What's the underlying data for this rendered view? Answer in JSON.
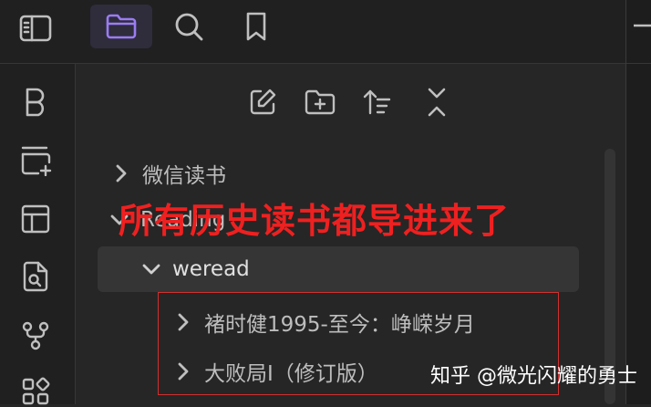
{
  "toolbar": {
    "icons": [
      "sidebar-toggle-icon",
      "folder-icon",
      "search-icon",
      "bookmark-icon"
    ],
    "active": "folder-icon"
  },
  "rail": {
    "icons": [
      "b-letter-icon",
      "add-card-icon",
      "layout-icon",
      "file-search-icon",
      "graph-icon",
      "grid-icon"
    ]
  },
  "file_panel_actions": [
    "new-note-icon",
    "new-folder-icon",
    "sort-icon",
    "collapse-all-icon"
  ],
  "tree": {
    "items": [
      {
        "label": "微信读书",
        "expanded": false
      },
      {
        "label": "Reading",
        "expanded": true
      },
      {
        "label": "weread",
        "expanded": true,
        "selected": true
      },
      {
        "label": "褚时健1995-至今：峥嵘岁月",
        "expanded": false
      },
      {
        "label": "大败局I（修订版）",
        "expanded": false
      }
    ]
  },
  "annotation": "所有历史读书都导进来了",
  "watermark": "知乎 @微光闪耀的勇士",
  "colors": {
    "accent": "#9a7cf2",
    "annotation": "#ef2020",
    "background": "#262626"
  }
}
